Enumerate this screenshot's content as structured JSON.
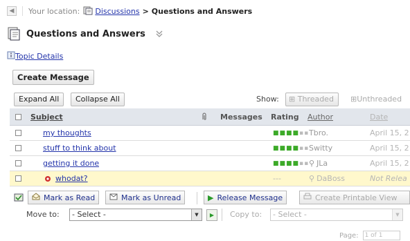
{
  "breadcrumb": {
    "label": "Your location:",
    "link": "Discussions",
    "separator": ">",
    "current": "Questions and Answers"
  },
  "page": {
    "title": "Questions and Answers",
    "topic_details": "Topic Details",
    "create_message": "Create Message"
  },
  "toolbar": {
    "expand_all": "Expand All",
    "collapse_all": "Collapse All",
    "show_label": "Show:",
    "threaded": "Threaded",
    "unthreaded": "Unthreaded"
  },
  "table": {
    "columns": {
      "subject": "Subject",
      "messages": "Messages",
      "rating": "Rating",
      "author": "Author",
      "date": "Date"
    },
    "rows": [
      {
        "subject": "my thoughts",
        "rating": 3,
        "author": "Tbro.",
        "date": "April 15, 2",
        "attachment": false
      },
      {
        "subject": "stuff to think about",
        "rating": 3,
        "author": "Switty",
        "date": "April 15, 2",
        "attachment": false
      },
      {
        "subject": "getting it done",
        "rating": 3,
        "author": "JLa",
        "date": "April 15, 2",
        "attachment": false
      },
      {
        "subject": "whodat?",
        "rating_text": "---",
        "author": "DaBoss",
        "date": "Not Relea",
        "unreleased": true
      }
    ],
    "rating_max": 5
  },
  "actions": {
    "mark_read": "Mark as Read",
    "mark_unread": "Mark as Unread",
    "release": "Release Message",
    "printable": "Create Printable View"
  },
  "move": {
    "move_label": "Move to:",
    "move_value": "- Select -",
    "copy_label": "Copy to:",
    "copy_value": "- Select -"
  },
  "pager": {
    "label": "Page:",
    "value": "1 of 1"
  },
  "colors": {
    "link": "#2233aa",
    "header_bg": "#e2e6ec",
    "highlight_bg": "#fff8cc",
    "rating_on": "#3caa28"
  }
}
